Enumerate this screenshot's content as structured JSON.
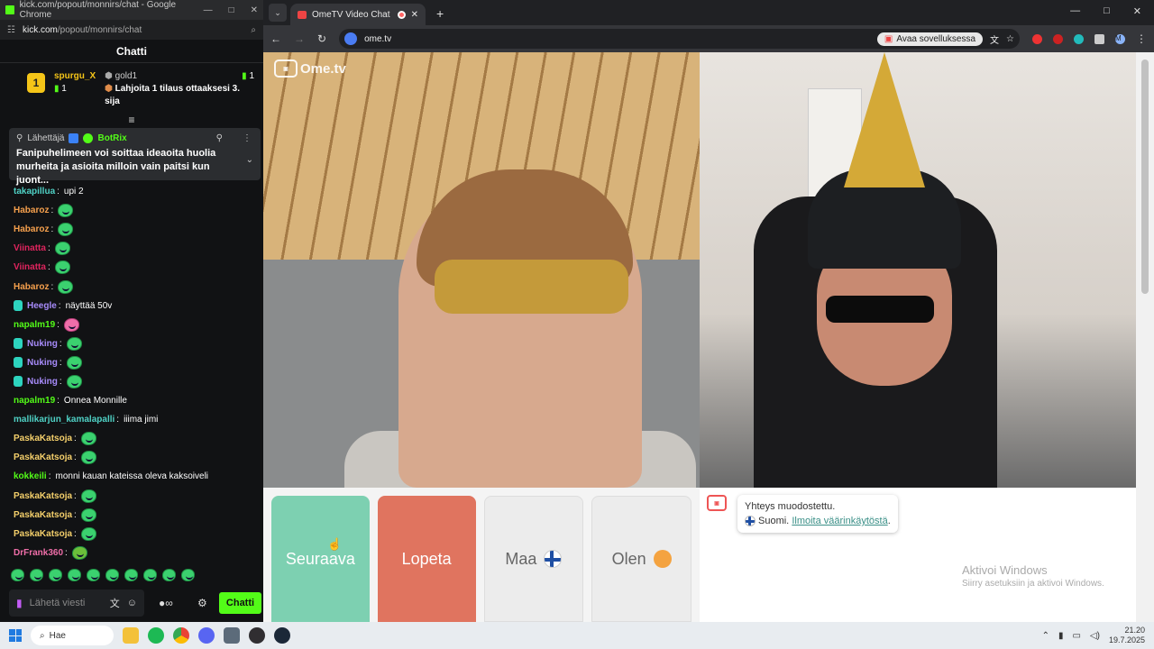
{
  "left_window": {
    "title": "kick.com/popout/monnirs/chat - Google Chrome",
    "url_host": "kick.com",
    "url_path": "/popout/monnirs/chat",
    "chat_title": "Chatti",
    "leaderboard": {
      "rank": "1",
      "top_user": "spurgu_X",
      "top_count": "1",
      "gold_label": "gold1",
      "gold_count": "1",
      "gift_text": "Lahjoita 1 tilaus ottaaksesi 3. sija"
    },
    "pinned": {
      "sender_label": "Lähettäjä",
      "sender": "BotRix",
      "message": "Fanipuhelimeen voi soittaa ideaoita huolia murheita ja asioita milloin vain paitsi kun juont..."
    },
    "messages": [
      {
        "user": "takapillua",
        "color": "#4fd1c5",
        "text": "upi 2",
        "emote": ""
      },
      {
        "user": "Habaroz",
        "color": "#f6a04d",
        "text": "",
        "emote": "green"
      },
      {
        "user": "Habaroz",
        "color": "#f6a04d",
        "text": "",
        "emote": "green"
      },
      {
        "user": "Viinatta",
        "color": "#e0245e",
        "text": "",
        "emote": "green"
      },
      {
        "user": "Viinatta",
        "color": "#e0245e",
        "text": "",
        "emote": "green"
      },
      {
        "user": "Habaroz",
        "color": "#f6a04d",
        "text": "",
        "emote": "green"
      },
      {
        "user": "Heegle",
        "color": "#a78bfa",
        "text": "näyttää 50v",
        "emote": "",
        "badge": true
      },
      {
        "user": "napalm19",
        "color": "#53fc18",
        "text": "",
        "emote": "pink"
      },
      {
        "user": "Nuking",
        "color": "#a78bfa",
        "text": "",
        "emote": "green",
        "badge": true
      },
      {
        "user": "Nuking",
        "color": "#a78bfa",
        "text": "",
        "emote": "green",
        "badge": true
      },
      {
        "user": "Nuking",
        "color": "#a78bfa",
        "text": "",
        "emote": "green",
        "badge": true
      },
      {
        "user": "napalm19",
        "color": "#53fc18",
        "text": "Onnea Monnille",
        "emote": ""
      },
      {
        "user": "mallikarjun_kamalapalli",
        "color": "#4fd1c5",
        "text": "iiima jimi",
        "emote": ""
      },
      {
        "user": "PaskaKatsoja",
        "color": "#f5d06b",
        "text": "",
        "emote": "green"
      },
      {
        "user": "PaskaKatsoja",
        "color": "#f5d06b",
        "text": "",
        "emote": "green"
      },
      {
        "user": "kokkeili",
        "color": "#53fc18",
        "text": "monni kauan kateissa oleva kaksoiveli",
        "emote": ""
      },
      {
        "user": "PaskaKatsoja",
        "color": "#f5d06b",
        "text": "",
        "emote": "green"
      },
      {
        "user": "PaskaKatsoja",
        "color": "#f5d06b",
        "text": "",
        "emote": "green"
      },
      {
        "user": "PaskaKatsoja",
        "color": "#f5d06b",
        "text": "",
        "emote": "green"
      },
      {
        "user": "DrFrank360",
        "color": "#f06ea9",
        "text": "",
        "emote": "frog"
      }
    ],
    "input_placeholder": "Lähetä viesti",
    "chat_button": "Chatti"
  },
  "right_window": {
    "tab_title": "OmeTV Video Chat — Ome",
    "url": "ome.tv",
    "open_app_label": "Avaa sovelluksessa",
    "profile_initial": "M",
    "logo_text": "Ome.tv",
    "buttons": {
      "next": "Seuraava",
      "stop": "Lopeta",
      "country": "Maa",
      "gender": "Olen"
    },
    "chat": {
      "line1": "Yhteys muodostettu.",
      "country_text": "Suomi.",
      "report_link": "Ilmoita väärinkäytöstä",
      "report_suffix": "."
    },
    "activate_windows": {
      "title": "Aktivoi Windows",
      "subtitle": "Siirry asetuksiin ja aktivoi Windows."
    }
  },
  "taskbar": {
    "search_label": "Hae",
    "time": "21.20",
    "date": "19.7.2025"
  }
}
